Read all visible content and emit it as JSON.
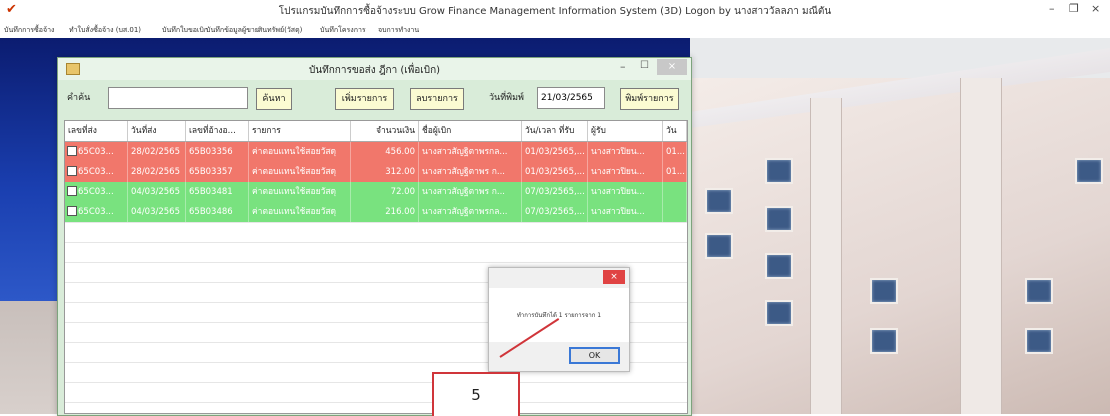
{
  "app": {
    "logo_glyph": "✔",
    "title": "โปรแกรมบันทึกการซื้อจ้างระบบ  Grow Finance Management Information System (3D) Logon by นางสาววัลลภา มณีตัน",
    "minimize": "–",
    "restore": "❐",
    "close": "×"
  },
  "menu": [
    "บันทึกการซื้อจ้าง",
    "ทำใบสั่งซื้อจ้าง (บส.01)",
    "บันทึกใบขอเบิก",
    "บันทึกข้อมูลผู้ขาย",
    "สินทรัพย์(วัสดุ)",
    "บันทึกโครงการ",
    "จบการทำงาน"
  ],
  "dialog": {
    "title": "บันทึกการขอส่ง ฎีกา (เพื่อเบิก)",
    "search_label": "คำค้น",
    "search_value": "",
    "search_button": "ค้นหา",
    "add_button": "เพิ่มรายการ",
    "delete_button": "ลบรายการ",
    "print_date_label": "วันที่พิมพ์",
    "print_date_value": "21/03/2565",
    "print_button": "พิมพ์รายการ",
    "minimize": "–",
    "maximize": "☐",
    "close": "×"
  },
  "grid": {
    "headers": [
      "เลขที่ส่ง",
      "วันที่ส่ง",
      "เลขที่อ้างอ...",
      "รายการ",
      "จำนวนเงิน",
      "ชื่อผู้เบิก",
      "วัน/เวลา ที่รับ",
      "ผู้รับ",
      "วัน"
    ],
    "rows": [
      {
        "status": "red",
        "cells": [
          "65C03...",
          "28/02/2565",
          "65B03356",
          "ค่าตอบแทนใช้สอยวัสดุ",
          "456.00",
          "นางสาวสัญฐิตาพรกล...",
          "01/03/2565,...",
          "นางสาวปิยน...",
          "01..."
        ]
      },
      {
        "status": "red",
        "cells": [
          "65C03...",
          "28/02/2565",
          "65B03357",
          "ค่าตอบแทนใช้สอยวัสดุ",
          "312.00",
          "นางสาวสัญฐิตาพร ก...",
          "01/03/2565,...",
          "นางสาวปิยน...",
          "01..."
        ]
      },
      {
        "status": "green",
        "cells": [
          "65C03...",
          "04/03/2565",
          "65B03481",
          "ค่าตอบแทนใช้สอยวัสดุ",
          "72.00",
          "นางสาวสัญฐิตาพร ก...",
          "07/03/2565,...",
          "นางสาวปิยน...",
          ""
        ]
      },
      {
        "status": "green",
        "cells": [
          "65C03...",
          "04/03/2565",
          "65B03486",
          "ค่าตอบแทนใช้สอยวัสดุ",
          "216.00",
          "นางสาวสัญฐิตาพรกล...",
          "07/03/2565,...",
          "นางสาวปิยน...",
          ""
        ]
      }
    ]
  },
  "message_box": {
    "close": "×",
    "text": "ทำการบันทึกได้ 1 รายการจาก 1",
    "ok_button": "OK"
  },
  "annotation": {
    "number": "5"
  },
  "colors": {
    "row_red": "#f1776b",
    "row_green": "#79e27f",
    "dialog_bg": "#d9ecd9"
  }
}
